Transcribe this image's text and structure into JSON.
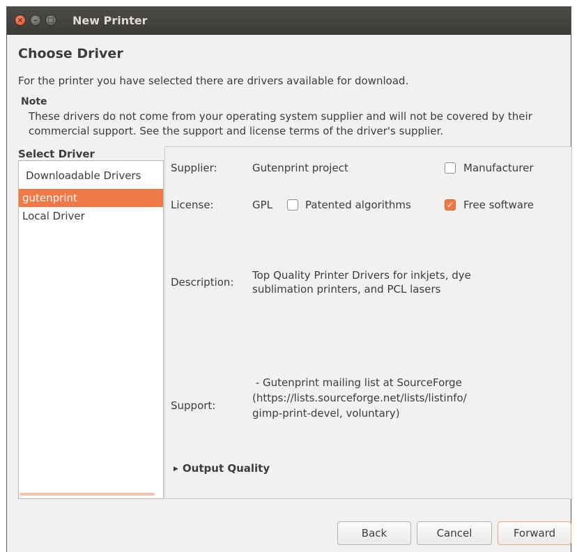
{
  "window": {
    "title": "New Printer",
    "controls": {
      "close": "×",
      "minimize": "–",
      "maximize": "□"
    }
  },
  "page": {
    "heading": "Choose Driver",
    "intro": "For the printer you have selected there are drivers available for download.",
    "note_title": "Note",
    "note_text": "These drivers do not come from your operating system supplier and will not be covered by their commercial support.  See the support and license terms of the driver's supplier."
  },
  "driver_list": {
    "label": "Select Driver",
    "header": "Downloadable Drivers",
    "items": [
      "gutenprint",
      "Local Driver"
    ],
    "selected": "gutenprint"
  },
  "details": {
    "supplier_label": "Supplier:",
    "supplier_value": "Gutenprint project",
    "manufacturer_label": "Manufacturer",
    "manufacturer_checked": false,
    "license_label": "License:",
    "license_value": "GPL",
    "patented_label": "Patented algorithms",
    "patented_checked": false,
    "free_label": "Free software",
    "free_checked": true,
    "description_label": "Description:",
    "description_line1": "Top Quality Printer Drivers for inkjets, dye",
    "description_line2": "sublimation printers, and PCL lasers",
    "support_label": "Support:",
    "support_line1": " - Gutenprint mailing list at SourceForge",
    "support_line2": "(https://lists.sourceforge.net/lists/listinfo/",
    "support_line3": "gimp-print-devel, voluntary)",
    "output_quality_label": "Output Quality",
    "output_quality_icon": "triangle-right-icon"
  },
  "buttons": {
    "back": "Back",
    "cancel": "Cancel",
    "forward": "Forward"
  },
  "colors": {
    "accent": "#f07746",
    "titlebar": "#3c3b37"
  }
}
